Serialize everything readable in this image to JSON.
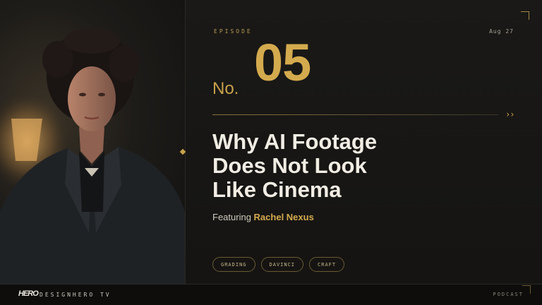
{
  "episode": {
    "label": "EPISODE",
    "number_prefix": "No.",
    "number": "05",
    "date": "Aug 27"
  },
  "title_lines": [
    "Why AI Footage",
    "Does Not Look",
    "Like Cinema"
  ],
  "featuring": {
    "prefix": "Featuring",
    "guest": "Rachel Nexus"
  },
  "tags": [
    "GRADING",
    "DAVINCI",
    "CRAFT"
  ],
  "footer": {
    "logo": "HERO",
    "brand": "DESIGNHERO TV",
    "category": "PODCAST"
  },
  "decor": {
    "arrows": "››",
    "accent_color": "#d4aa4e"
  }
}
